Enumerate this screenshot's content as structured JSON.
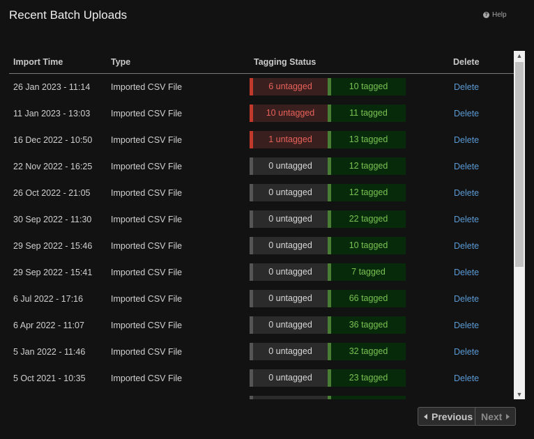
{
  "header": {
    "title": "Recent Batch Uploads",
    "help_label": "Help"
  },
  "table": {
    "columns": {
      "import_time": "Import Time",
      "type": "Type",
      "tagging_status": "Tagging Status",
      "delete": "Delete"
    },
    "rows": [
      {
        "time": "26 Jan 2023 - 11:14",
        "type": "Imported CSV File",
        "untagged": "6 untagged",
        "tagged": "10 tagged",
        "untagged_count": 6,
        "delete": "Delete"
      },
      {
        "time": "11 Jan 2023 - 13:03",
        "type": "Imported CSV File",
        "untagged": "10 untagged",
        "tagged": "11 tagged",
        "untagged_count": 10,
        "delete": "Delete"
      },
      {
        "time": "16 Dec 2022 - 10:50",
        "type": "Imported CSV File",
        "untagged": "1 untagged",
        "tagged": "13 tagged",
        "untagged_count": 1,
        "delete": "Delete"
      },
      {
        "time": "22 Nov 2022 - 16:25",
        "type": "Imported CSV File",
        "untagged": "0 untagged",
        "tagged": "12 tagged",
        "untagged_count": 0,
        "delete": "Delete"
      },
      {
        "time": "26 Oct 2022 - 21:05",
        "type": "Imported CSV File",
        "untagged": "0 untagged",
        "tagged": "12 tagged",
        "untagged_count": 0,
        "delete": "Delete"
      },
      {
        "time": "30 Sep 2022 - 11:30",
        "type": "Imported CSV File",
        "untagged": "0 untagged",
        "tagged": "22 tagged",
        "untagged_count": 0,
        "delete": "Delete"
      },
      {
        "time": "29 Sep 2022 - 15:46",
        "type": "Imported CSV File",
        "untagged": "0 untagged",
        "tagged": "10 tagged",
        "untagged_count": 0,
        "delete": "Delete"
      },
      {
        "time": "29 Sep 2022 - 15:41",
        "type": "Imported CSV File",
        "untagged": "0 untagged",
        "tagged": "7 tagged",
        "untagged_count": 0,
        "delete": "Delete"
      },
      {
        "time": "6 Jul 2022 - 17:16",
        "type": "Imported CSV File",
        "untagged": "0 untagged",
        "tagged": "66 tagged",
        "untagged_count": 0,
        "delete": "Delete"
      },
      {
        "time": "6 Apr 2022 - 11:07",
        "type": "Imported CSV File",
        "untagged": "0 untagged",
        "tagged": "36 tagged",
        "untagged_count": 0,
        "delete": "Delete"
      },
      {
        "time": "5 Jan 2022 - 11:46",
        "type": "Imported CSV File",
        "untagged": "0 untagged",
        "tagged": "32 tagged",
        "untagged_count": 0,
        "delete": "Delete"
      },
      {
        "time": "5 Oct 2021 - 10:35",
        "type": "Imported CSV File",
        "untagged": "0 untagged",
        "tagged": "23 tagged",
        "untagged_count": 0,
        "delete": "Delete"
      },
      {
        "time": "",
        "type": "",
        "untagged": "",
        "tagged": "",
        "untagged_count": 0,
        "delete": ""
      }
    ]
  },
  "pagination": {
    "previous_label": "Previous",
    "next_label": "Next"
  },
  "colors": {
    "background": "#121212",
    "untagged_alert": "#e8625a",
    "tagged": "#79c451",
    "link": "#5b9bd5"
  },
  "icons": {
    "help": "question-circle-icon",
    "previous": "caret-left-icon",
    "next": "caret-right-icon"
  }
}
